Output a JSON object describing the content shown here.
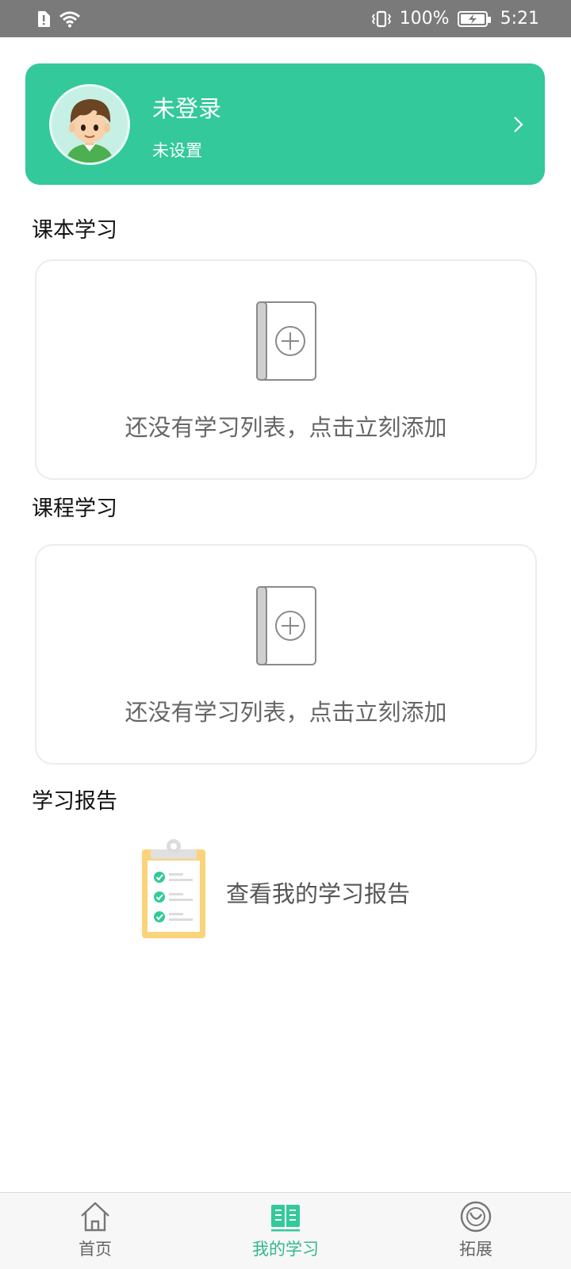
{
  "status_bar": {
    "battery": "100%",
    "time": "5:21"
  },
  "profile": {
    "name": "未登录",
    "subtitle": "未设置"
  },
  "sections": {
    "textbook": {
      "title": "课本学习",
      "empty_text": "还没有学习列表，点击立刻添加"
    },
    "course": {
      "title": "课程学习",
      "empty_text": "还没有学习列表，点击立刻添加"
    },
    "report": {
      "title": "学习报告",
      "link_text": "查看我的学习报告"
    }
  },
  "bottom_nav": {
    "items": [
      {
        "label": "首页",
        "icon": "home-icon",
        "active": false
      },
      {
        "label": "我的学习",
        "icon": "open-book-icon",
        "active": true
      },
      {
        "label": "拓展",
        "icon": "explore-icon",
        "active": false
      }
    ]
  },
  "colors": {
    "accent": "#33c99a",
    "active_tab": "#2fb98d",
    "status_bar": "#7a7a7a"
  }
}
